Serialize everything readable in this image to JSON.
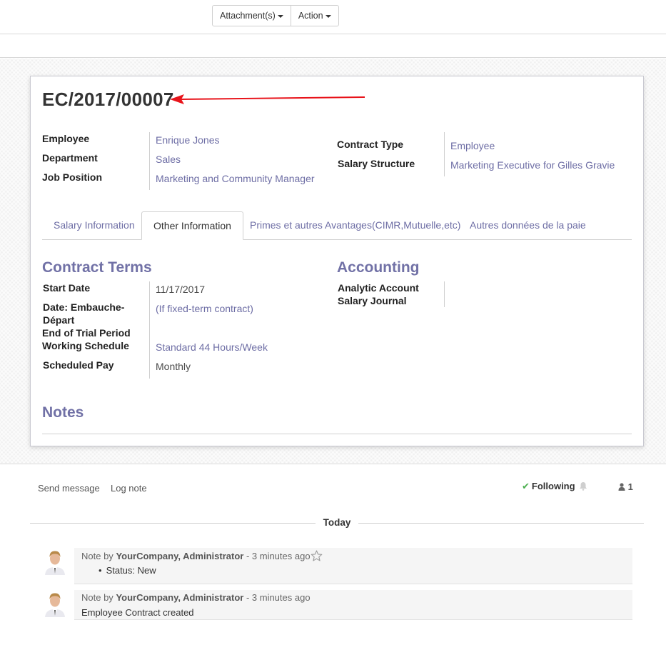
{
  "toolbar": {
    "attachments_label": "Attachment(s)",
    "action_label": "Action"
  },
  "record": {
    "reference": "EC/2017/00007"
  },
  "header_fields": {
    "employee_label": "Employee",
    "employee_value": "Enrique Jones",
    "department_label": "Department",
    "department_value": "Sales",
    "job_position_label": "Job Position",
    "job_position_value": "Marketing and Community Manager",
    "contract_type_label": "Contract Type",
    "contract_type_value": "Employee",
    "salary_structure_label": "Salary Structure",
    "salary_structure_value": "Marketing Executive for Gilles Gravie"
  },
  "tabs": [
    {
      "label": "Salary Information",
      "active": false
    },
    {
      "label": "Other Information",
      "active": true
    },
    {
      "label": "Primes et autres Avantages(CIMR,Mutuelle,etc)",
      "active": false
    },
    {
      "label": "Autres données de la paie",
      "active": false
    }
  ],
  "contract_terms": {
    "title": "Contract Terms",
    "start_date_label": "Start Date",
    "start_date_value": "11/17/2017",
    "end_date_label_1": "Date: Embauche-",
    "end_date_label_2": "Départ",
    "end_date_placeholder": "(If fixed-term contract)",
    "trial_label": "End of Trial Period",
    "working_schedule_label": "Working Schedule",
    "working_schedule_value": "Standard 44 Hours/Week",
    "scheduled_pay_label": "Scheduled Pay",
    "scheduled_pay_value": "Monthly"
  },
  "accounting": {
    "title": "Accounting",
    "analytic_account_label": "Analytic Account",
    "salary_journal_label": "Salary Journal"
  },
  "notes": {
    "title": "Notes"
  },
  "chatter": {
    "send_message": "Send message",
    "log_note": "Log note",
    "following": "Following",
    "followers_count": "1",
    "date_separator": "Today",
    "messages": [
      {
        "prefix": "Note by",
        "author": "YourCompany, Administrator",
        "time": "- 3 minutes ago",
        "bullet": "Status: New"
      },
      {
        "prefix": "Note by",
        "author": "YourCompany, Administrator",
        "time": "- 3 minutes ago",
        "body": "Employee Contract created"
      }
    ]
  },
  "colors": {
    "accent": "#7c7bad",
    "annotation_arrow": "#e8141b",
    "following_check": "#4caf50"
  }
}
